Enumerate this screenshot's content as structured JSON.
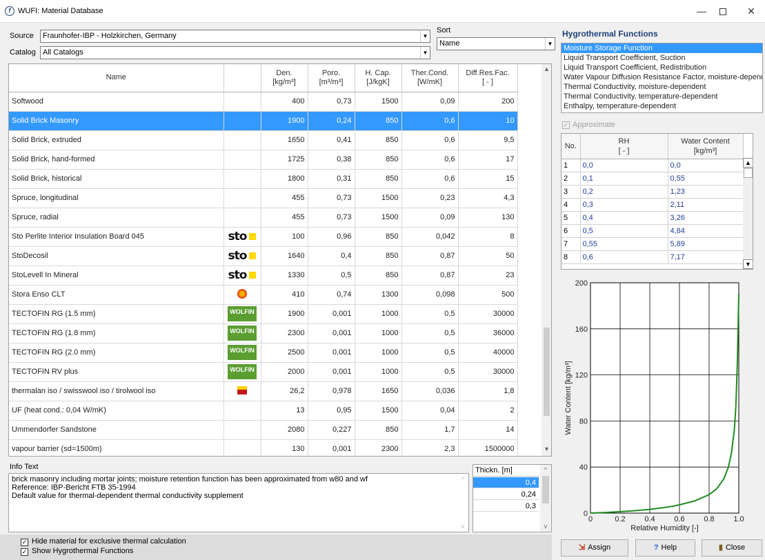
{
  "window": {
    "title": "WUFI: Material Database"
  },
  "source": {
    "label": "Source",
    "value": "Fraunhofer-IBP - Holzkirchen, Germany"
  },
  "catalog": {
    "label": "Catalog",
    "value": "All Catalogs"
  },
  "sort": {
    "label": "Sort",
    "value": "Name"
  },
  "grid": {
    "headers": [
      {
        "l1": "Name",
        "l2": ""
      },
      {
        "l1": "",
        "l2": ""
      },
      {
        "l1": "Den.",
        "l2": "[kg/m³]"
      },
      {
        "l1": "Poro.",
        "l2": "[m³/m³]"
      },
      {
        "l1": "H. Cap.",
        "l2": "[J/kgK]"
      },
      {
        "l1": "Ther.Cond.",
        "l2": "[W/mK]"
      },
      {
        "l1": "Diff.Res.Fac.",
        "l2": "[ - ]"
      }
    ],
    "rows": [
      {
        "name": "Softwood",
        "logo": "",
        "den": "400",
        "poro": "0,73",
        "hcap": "1500",
        "tc": "0,09",
        "drf": "200"
      },
      {
        "name": "Solid Brick Masonry",
        "logo": "",
        "den": "1900",
        "poro": "0,24",
        "hcap": "850",
        "tc": "0,6",
        "drf": "10",
        "selected": true
      },
      {
        "name": "Solid Brick, extruded",
        "logo": "",
        "den": "1650",
        "poro": "0,41",
        "hcap": "850",
        "tc": "0,6",
        "drf": "9,5"
      },
      {
        "name": "Solid Brick, hand-formed",
        "logo": "",
        "den": "1725",
        "poro": "0,38",
        "hcap": "850",
        "tc": "0,6",
        "drf": "17"
      },
      {
        "name": "Solid Brick, historical",
        "logo": "",
        "den": "1800",
        "poro": "0,31",
        "hcap": "850",
        "tc": "0,6",
        "drf": "15"
      },
      {
        "name": "Spruce, longitudinal",
        "logo": "",
        "den": "455",
        "poro": "0,73",
        "hcap": "1500",
        "tc": "0,23",
        "drf": "4,3"
      },
      {
        "name": "Spruce, radial",
        "logo": "",
        "den": "455",
        "poro": "0,73",
        "hcap": "1500",
        "tc": "0,09",
        "drf": "130"
      },
      {
        "name": "Sto Perlite Interior Insulation Board 045",
        "logo": "sto",
        "den": "100",
        "poro": "0,96",
        "hcap": "850",
        "tc": "0,042",
        "drf": "8"
      },
      {
        "name": "StoDecosil",
        "logo": "sto",
        "den": "1640",
        "poro": "0,4",
        "hcap": "850",
        "tc": "0,87",
        "drf": "50"
      },
      {
        "name": "StoLevell In Mineral",
        "logo": "sto",
        "den": "1330",
        "poro": "0,5",
        "hcap": "850",
        "tc": "0,87",
        "drf": "23"
      },
      {
        "name": "Stora Enso CLT",
        "logo": "stora",
        "den": "410",
        "poro": "0,74",
        "hcap": "1300",
        "tc": "0,098",
        "drf": "500"
      },
      {
        "name": "TECTOFIN RG (1.5 mm)",
        "logo": "wolfin",
        "den": "1900",
        "poro": "0,001",
        "hcap": "1000",
        "tc": "0,5",
        "drf": "30000"
      },
      {
        "name": "TECTOFIN RG (1.8 mm)",
        "logo": "wolfin",
        "den": "2300",
        "poro": "0,001",
        "hcap": "1000",
        "tc": "0,5",
        "drf": "36000"
      },
      {
        "name": "TECTOFIN RG (2.0 mm)",
        "logo": "wolfin",
        "den": "2500",
        "poro": "0,001",
        "hcap": "1000",
        "tc": "0,5",
        "drf": "40000"
      },
      {
        "name": "TECTOFIN RV plus",
        "logo": "wolfin",
        "den": "2000",
        "poro": "0,001",
        "hcap": "1000",
        "tc": "0,5",
        "drf": "30000"
      },
      {
        "name": "thermalan iso / swisswool iso / tirolwool iso",
        "logo": "thermalan",
        "den": "26,2",
        "poro": "0,978",
        "hcap": "1650",
        "tc": "0,036",
        "drf": "1,8"
      },
      {
        "name": "UF (heat cond.: 0,04 W/mK)",
        "logo": "",
        "den": "13",
        "poro": "0,95",
        "hcap": "1500",
        "tc": "0,04",
        "drf": "2"
      },
      {
        "name": "Ummendorfer Sandstone",
        "logo": "",
        "den": "2080",
        "poro": "0,227",
        "hcap": "850",
        "tc": "1,7",
        "drf": "14"
      },
      {
        "name": "vapour barrier (sd=1500m)",
        "logo": "",
        "den": "130",
        "poro": "0,001",
        "hcap": "2300",
        "tc": "2,3",
        "drf": "1500000"
      }
    ],
    "logos": {
      "sto": "sto",
      "wolfin": "WOLFIN"
    }
  },
  "info": {
    "label": "Info Text",
    "lines": [
      "brick masonry including mortar joints; moisture retention function has been approximated from w80 and wf",
      "Reference: IBP-Bericht FTB 35-1994",
      "Default value for thermal-dependent thermal conductivity supplement"
    ]
  },
  "thickness": {
    "header": "Thickn. [m]",
    "values": [
      "0,4",
      "0,24",
      "0,3"
    ],
    "selected_index": 0
  },
  "options": {
    "hide_thermal": {
      "label": "Hide material for exclusive thermal calculation",
      "checked": true
    },
    "show_hygro": {
      "label": "Show Hygrothermal Functions",
      "checked": true
    }
  },
  "hygro": {
    "title": "Hygrothermal Functions",
    "functions": [
      "Moisture Storage Function",
      "Liquid Transport Coefficient, Suction",
      "Liquid Transport Coefficient, Redistribution",
      "Water Vapour Diffusion Resistance Factor, moisture-dependent",
      "Thermal Conductivity, moisture-dependent",
      "Thermal Conductivity, temperature-dependent",
      "Enthalpy, temperature-dependent"
    ],
    "selected_index": 0,
    "approximate": {
      "label": "Approximate",
      "checked": true
    },
    "table": {
      "col_no": "No.",
      "col_rh": "RH",
      "col_rh_unit": "[ - ]",
      "col_wc": "Water Content",
      "col_wc_unit": "[kg/m³]",
      "rows": [
        {
          "no": "1",
          "rh": "0,0",
          "wc": "0,0"
        },
        {
          "no": "2",
          "rh": "0,1",
          "wc": "0,55"
        },
        {
          "no": "3",
          "rh": "0,2",
          "wc": "1,23"
        },
        {
          "no": "4",
          "rh": "0,3",
          "wc": "2,11"
        },
        {
          "no": "5",
          "rh": "0,4",
          "wc": "3,26"
        },
        {
          "no": "6",
          "rh": "0,5",
          "wc": "4,84"
        },
        {
          "no": "7",
          "rh": "0,55",
          "wc": "5,89"
        },
        {
          "no": "8",
          "rh": "0,6",
          "wc": "7,17"
        }
      ]
    }
  },
  "chart_data": {
    "type": "line",
    "title": "",
    "xlabel": "Relative Humidity [-]",
    "ylabel": "Water Content [kg/m³]",
    "xlim": [
      0,
      1.0
    ],
    "ylim": [
      0,
      200
    ],
    "xticks": [
      "0",
      "0.2",
      "0.4",
      "0.6",
      "0.8",
      "1.0"
    ],
    "yticks": [
      "0",
      "40",
      "80",
      "120",
      "160",
      "200"
    ],
    "grid": true,
    "series": [
      {
        "color": "#1f8a1f",
        "x": [
          0.0,
          0.1,
          0.2,
          0.3,
          0.4,
          0.5,
          0.55,
          0.6,
          0.7,
          0.8,
          0.85,
          0.9,
          0.93,
          0.95,
          0.97,
          0.98,
          0.99,
          1.0
        ],
        "y": [
          0.0,
          0.55,
          1.23,
          2.11,
          3.26,
          4.84,
          5.89,
          7.17,
          10.5,
          16,
          21,
          30,
          40,
          52,
          72,
          92,
          130,
          190
        ]
      }
    ]
  },
  "buttons": {
    "assign": "Assign",
    "help": "Help",
    "close": "Close"
  }
}
